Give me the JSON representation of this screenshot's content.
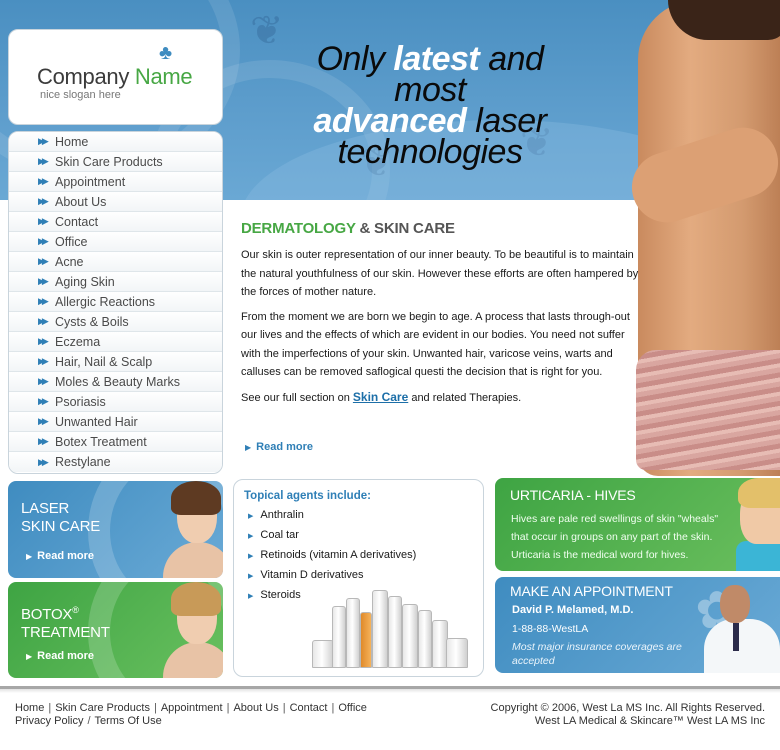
{
  "header": {
    "tagline_part1": "Only ",
    "tagline_hl1": "latest",
    "tagline_part2": " and most",
    "tagline_hl2": "advanced",
    "tagline_part3": " laser technologies"
  },
  "logo": {
    "company": "Company",
    "name": "Name",
    "slogan": "nice slogan here",
    "icon": "palm-tree-icon"
  },
  "nav": {
    "items": [
      {
        "label": "Home"
      },
      {
        "label": "Skin Care Products"
      },
      {
        "label": "Appointment"
      },
      {
        "label": "About Us"
      },
      {
        "label": "Contact"
      },
      {
        "label": "Office"
      },
      {
        "label": "Acne"
      },
      {
        "label": "Aging Skin"
      },
      {
        "label": "Allergic Reactions"
      },
      {
        "label": "Cysts & Boils"
      },
      {
        "label": "Eczema"
      },
      {
        "label": "Hair, Nail & Scalp"
      },
      {
        "label": "Moles & Beauty Marks"
      },
      {
        "label": "Psoriasis"
      },
      {
        "label": "Unwanted Hair"
      },
      {
        "label": "Botex Treatment"
      },
      {
        "label": "Restylane"
      }
    ]
  },
  "main": {
    "title_accent": "DERMATOLOGY",
    "title_rest": " & SKIN CARE",
    "para1": "Our skin is outer representation of our inner beauty. To be beautiful is to maintain the natural youthfulness of our skin. However these efforts are often hampered by the forces of mother nature.",
    "para2": "From the moment we are born we begin to age. A process that lasts through-out our lives and the effects of which are evident in our bodies. You need not suffer with the imperfections of your skin. Unwanted hair, varicose veins, warts and calluses can be removed saflogical questi the decision that is right for you.",
    "para3_before": "See our full section on ",
    "para3_link": "Skin Care",
    "para3_after": " and related Therapies.",
    "read_more": "Read more"
  },
  "promos": {
    "laser_title_1": "LASER",
    "laser_title_2": "SKIN CARE",
    "laser_read_more": "Read more",
    "botox_title_1": "BOTOX",
    "botox_reg": "®",
    "botox_title_2": "TREATMENT",
    "botox_read_more": "Read more"
  },
  "topical": {
    "title": "Topical agents include:",
    "items": [
      "Anthralin",
      "Coal tar",
      "Retinoids (vitamin A derivatives)",
      "Vitamin D derivatives",
      "Steroids"
    ]
  },
  "urticaria": {
    "title": "URTICARIA - HIVES",
    "text": "Hives are pale red swellings of skin \"wheals\" that occur in groups on any part of the skin. Urticaria is the medical word for hives."
  },
  "appointment": {
    "title": "MAKE AN APPOINTMENT",
    "doctor": "David P. Melamed, M.D.",
    "phone": "1-88-88-WestLA",
    "note": "Most major insurance coverages are accepted"
  },
  "footer": {
    "links": [
      "Home",
      "Skin Care Products",
      "Appointment",
      "About Us",
      "Contact",
      "Office"
    ],
    "privacy": "Privacy Policy",
    "terms": "Terms Of Use",
    "copyright": "Copyright © 2006, West La MS Inc. All Rights Reserved.",
    "company_line": "West LA Medical & Skincare™ West LA MS Inc"
  },
  "colors": {
    "brand_blue": "#3f8cc0",
    "brand_green": "#47a744"
  }
}
